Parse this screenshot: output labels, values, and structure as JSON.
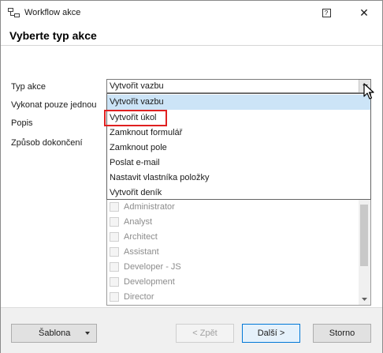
{
  "window": {
    "title": "Workflow akce",
    "help_label": "?",
    "close_label": "✕"
  },
  "heading": "Vyberte typ akce",
  "form": {
    "labels": {
      "typ_akce": "Typ akce",
      "vykonat": "Vykonat pouze jednou",
      "popis": "Popis",
      "zpusob": "Způsob dokončení"
    },
    "combo": {
      "value": "Vytvořit vazbu"
    }
  },
  "dropdown": {
    "items": [
      {
        "label": "Vytvořit vazbu",
        "selected": true
      },
      {
        "label": "Vytvořit úkol",
        "highlighted": true
      },
      {
        "label": "Zamknout formulář"
      },
      {
        "label": "Zamknout pole"
      },
      {
        "label": "Poslat e-mail"
      },
      {
        "label": "Nastavit vlastníka položky"
      },
      {
        "label": "Vytvořit deník"
      }
    ]
  },
  "roles": [
    "Administrator",
    "Analyst",
    "Architect",
    "Assistant",
    "Developer - JS",
    "Development",
    "Director"
  ],
  "footer": {
    "sablona": "Šablona",
    "zpet": "< Zpět",
    "dalsi": "Další >",
    "storno": "Storno"
  },
  "colors": {
    "highlight_border": "#e02020",
    "selected_item_bg": "#cce4f7",
    "primary_button_border": "#0078d7"
  },
  "icons": {
    "app": "workflow-icon",
    "cursor": "mouse-pointer-icon"
  }
}
